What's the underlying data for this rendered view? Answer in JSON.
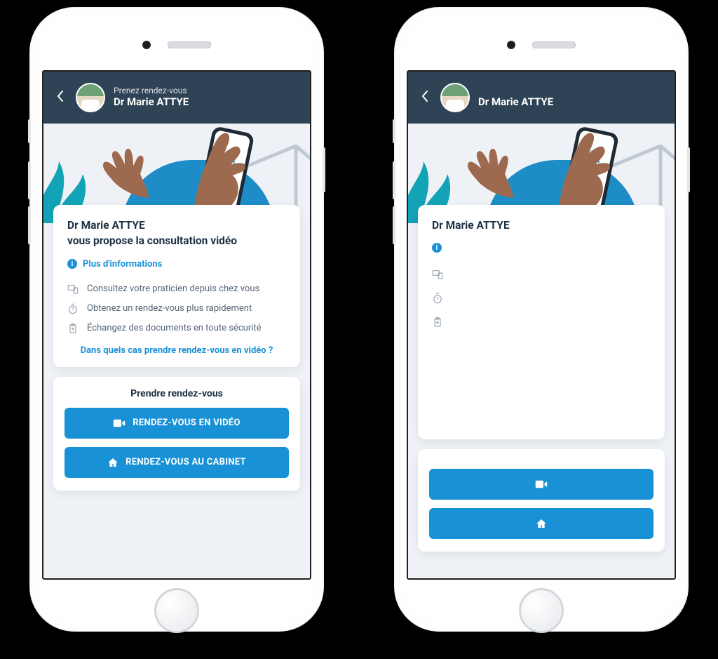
{
  "header": {
    "pre_title": "Prenez rendez-vous",
    "doctor_name": "Dr Marie ATTYE"
  },
  "mainCard": {
    "title_line1": "Dr Marie ATTYE",
    "title_line2": "vous propose la consultation vidéo",
    "info_link": "Plus d'informations",
    "bullets": [
      "Consultez votre praticien depuis chez vous",
      "Obtenez un rendez-vous plus rapidement",
      "Échangez des documents en toute sécurité"
    ],
    "video_when": "Dans quels cas prendre rendez-vous en vidéo ?"
  },
  "ctaCard": {
    "heading": "Prendre rendez-vous",
    "btn_video": "RENDEZ-VOUS EN VIDÉO",
    "btn_office": "RENDEZ-VOUS AU CABINET"
  }
}
